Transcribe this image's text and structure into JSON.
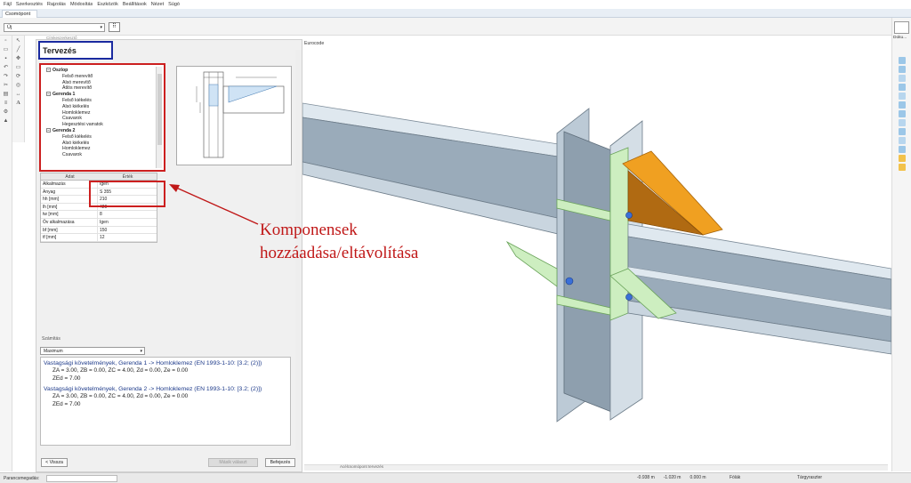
{
  "menu": [
    "Fájl",
    "Szerkesztés",
    "Rajzolás",
    "Módosítás",
    "Eszközök",
    "Beállítások",
    "Nézet",
    "Súgó"
  ],
  "tab": "Csomópont",
  "combo": {
    "value": "Új"
  },
  "panel": {
    "top_text": "Címkeszerkesztő",
    "title": "Tervezés",
    "tree": [
      {
        "label": "Oszlop",
        "level": 0
      },
      {
        "label": "Felső merevítő",
        "level": 1
      },
      {
        "label": "Alsó merevítő",
        "level": 1
      },
      {
        "label": "Átlós merevítő",
        "level": 1
      },
      {
        "label": "Gerenda 1",
        "level": 0
      },
      {
        "label": "Felső kiékelés",
        "level": 1
      },
      {
        "label": "Alsó kiékelés",
        "level": 1
      },
      {
        "label": "Homloklemez",
        "level": 1
      },
      {
        "label": "Csavarok",
        "level": 1
      },
      {
        "label": "Hegesztési varratok",
        "level": 1
      },
      {
        "label": "Gerenda 2",
        "level": 0
      },
      {
        "label": "Felső kiékelés",
        "level": 1
      },
      {
        "label": "Alsó kiékelés",
        "level": 1
      },
      {
        "label": "Homloklemez",
        "level": 1
      },
      {
        "label": "Csavarok",
        "level": 1
      }
    ],
    "props_header": {
      "key": "Adat",
      "value": "Érték"
    },
    "props": [
      {
        "key": "Alkalmazás",
        "value": "Igen"
      },
      {
        "key": "Anyag",
        "value": "S 355"
      },
      {
        "key": "hh [mm]",
        "value": "210"
      },
      {
        "key": "lh [mm]",
        "value": "420"
      },
      {
        "key": "tw [mm]",
        "value": "8"
      },
      {
        "key": "Öv alkalmazása",
        "value": "Igen"
      },
      {
        "key": "bf [mm]",
        "value": "150"
      },
      {
        "key": "tf [mm]",
        "value": "12"
      }
    ],
    "calc_label": "Számítás",
    "calc_select": "Maximum",
    "calc_results": [
      {
        "head": "Vastagsági követelmények, Gerenda 1 -> Homloklemez (EN 1993-1-10: [3.2; (2)])",
        "line1": "ZA = 3.00, ZB = 0.00, ZC = 4.00, Zd = 0.00, Ze = 0.00",
        "line2": "ZEd = 7.00"
      },
      {
        "head": "Vastagsági követelmények, Gerenda 2 -> Homloklemez (EN 1993-1-10: [3.2; (2)])",
        "line1": "ZA = 3.00, ZB = 0.00, ZC = 4.00, Zd = 0.00, Ze = 0.00",
        "line2": "ZEd = 7.00"
      }
    ],
    "buttons": {
      "back": "< Vissza",
      "other": "Másik választ",
      "finish": "Befejezés"
    }
  },
  "view": {
    "label": "Eurocode",
    "tab": "Acélcsomópont tervezés"
  },
  "annotation": {
    "line1": "Komponensek",
    "line2": "hozzáadása/eltávolítása",
    "color": "#c01818"
  },
  "right_panel": {
    "label": "Doku..."
  },
  "status": {
    "cmd_label": "Parancsmegadás:",
    "x": "-0.938 m",
    "y": "-1.020 m",
    "z": "0.000 m",
    "snap": "Fólák",
    "target": "Tárgyraszter"
  },
  "colors": {
    "steel": "#8fa3b5",
    "stiffener": "#cdeec0",
    "haunch": "#f0a021",
    "highlight_red": "#cc1f1f",
    "title_blue": "#1a2aa0"
  }
}
